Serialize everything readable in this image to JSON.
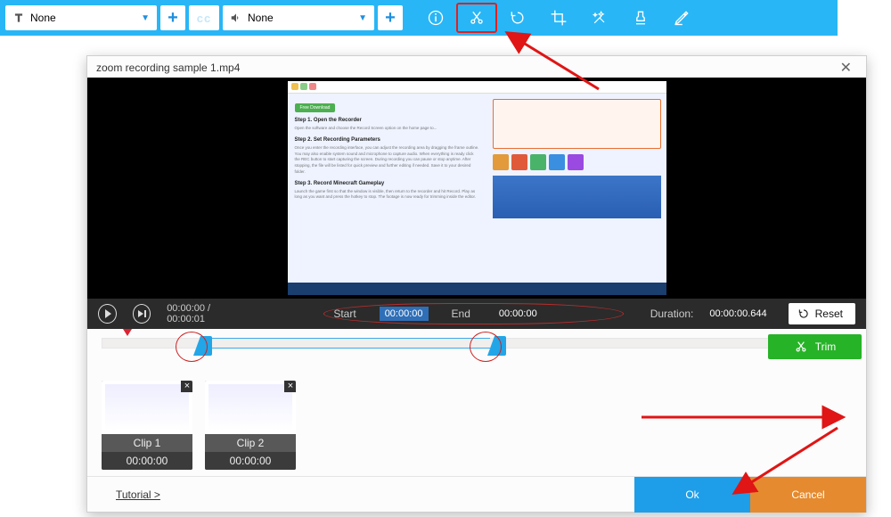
{
  "toolbar": {
    "text_select": "None",
    "audio_select": "None",
    "icons": [
      "info",
      "cut",
      "undo",
      "crop",
      "effects",
      "stamp",
      "marker"
    ]
  },
  "modal": {
    "title": "zoom recording sample 1.mp4",
    "thumb": {
      "greenbtn": "Free Download",
      "step1_h": "Step 1. Open the Recorder",
      "step1_p": "Open the software and choose the Record Screen option on the home page to...",
      "step2_h": "Step 2. Set Recording Parameters",
      "step2_p": "Once you enter the recording interface, you can adjust the recording area by dragging the frame outline. You may also enable system sound and microphone to capture audio. When everything is ready click the REC button to start capturing the screen. During recording you can pause or stop anytime. After stopping, the file will be listed for quick preview and further editing if needed. Save it to your desired folder.",
      "step3_h": "Step 3. Record Minecraft Gameplay",
      "step3_p": "Launch the game first so that the window is visible, then return to the recorder and hit Record. Play as long as you want and press the hotkey to stop. The footage is now ready for trimming inside the editor."
    },
    "playbar": {
      "play_time": "00:00:00 / 00:00:01",
      "start_label": "Start",
      "start_val": "00:00:00",
      "end_label": "End",
      "end_val": "00:00:00",
      "dur_label": "Duration:",
      "dur_val": "00:00:00.644",
      "reset": "Reset"
    },
    "trim_label": "Trim",
    "clips": [
      {
        "name": "Clip 1",
        "time": "00:00:00"
      },
      {
        "name": "Clip 2",
        "time": "00:00:00"
      }
    ],
    "footer": {
      "tutorial": "Tutorial >",
      "ok": "Ok",
      "cancel": "Cancel"
    }
  }
}
